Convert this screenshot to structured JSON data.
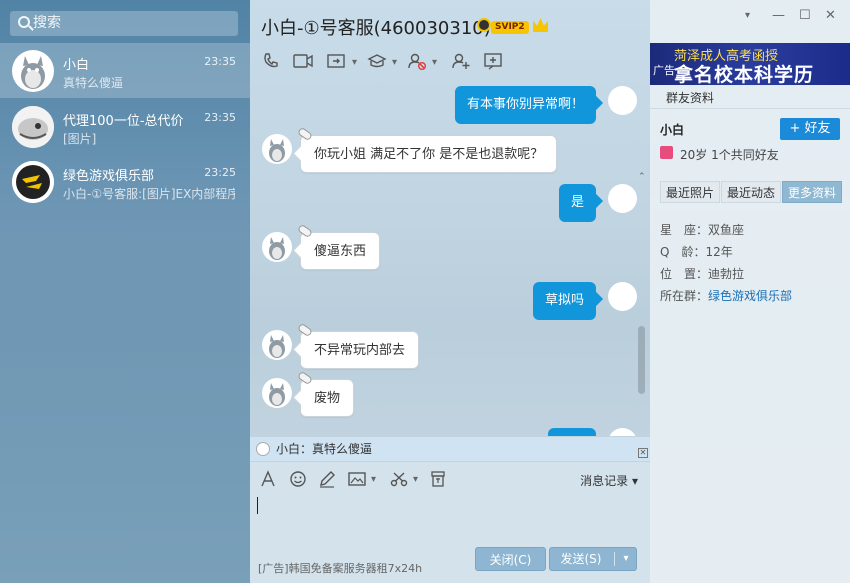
{
  "search": {
    "placeholder": "搜索"
  },
  "conversations": [
    {
      "name": "小白",
      "preview": "真特么傻逼",
      "time": "23:35"
    },
    {
      "name": "代理100一位-总代价",
      "preview": "[图片]",
      "time": "23:35"
    },
    {
      "name": "绿色游戏俱乐部",
      "preview": "小白-①号客服:[图片]EX内部程序",
      "time": "23:25"
    }
  ],
  "chat": {
    "title": "小白-①号客服(460030310)",
    "vip_badge": "SVIP2",
    "toolbar_icons": [
      "phone-icon",
      "video-icon",
      "share-screen-icon",
      "apps-icon",
      "block-user-icon",
      "add-user-icon",
      "edit-icon"
    ],
    "messages": [
      {
        "side": "right",
        "text": "有本事你别异常啊！"
      },
      {
        "side": "left",
        "text": "你玩小姐 满足不了你 是不是也退款呢？"
      },
      {
        "side": "right",
        "text": "是"
      },
      {
        "side": "left",
        "text": "傻逼东西"
      },
      {
        "side": "right",
        "text": "草拟吗"
      },
      {
        "side": "left",
        "text": "不异常玩内部去"
      },
      {
        "side": "left",
        "text": "废物"
      }
    ],
    "notice": "小白：真特么傻逼",
    "input_toolbar_icons": [
      "font-icon",
      "emoji-icon",
      "pen-icon",
      "image-icon",
      "scissors-icon",
      "archive-icon"
    ],
    "history_label": "消息记录",
    "ad_text": "[广告]韩国免备案服务器租7x24h",
    "close_label": "关闭(C)",
    "send_label": "发送(S)"
  },
  "profile": {
    "banner_line1": "菏泽成人高考函授",
    "banner_line2": "拿名校本科学历",
    "banner_ad": "广告",
    "group_tab": "群友资料",
    "name": "小白",
    "add_friend": "+ 好友",
    "info": "20岁 1个共同好友",
    "tabs": [
      "最近照片",
      "最近动态",
      "更多资料"
    ],
    "fields": [
      {
        "label": "星　座：",
        "value": "双鱼座"
      },
      {
        "label": "Q　龄：",
        "value": "12年"
      },
      {
        "label": "位　置：",
        "value": "迪勃拉"
      },
      {
        "label": "所在群：",
        "value": "绿色游戏俱乐部"
      }
    ]
  },
  "colors": {
    "accent": "#1296db",
    "bubble_right": "#1296db",
    "button": "#8eb6d2"
  }
}
